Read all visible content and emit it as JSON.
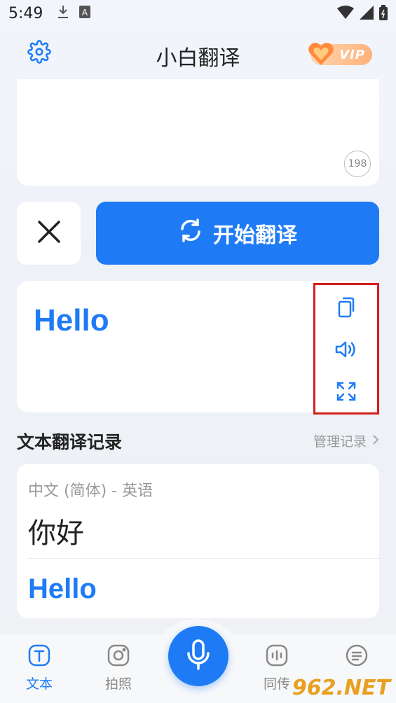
{
  "status_bar": {
    "time": "5:49",
    "icons": [
      "download-icon",
      "a-icon",
      "wifi-icon",
      "signal-icon",
      "battery-icon"
    ]
  },
  "header": {
    "title": "小白翻译",
    "vip_label": "VIP"
  },
  "input": {
    "char_count": "198"
  },
  "actions": {
    "translate_label": "开始翻译"
  },
  "result": {
    "text": "Hello",
    "action_icons": [
      "copy-icon",
      "speaker-icon",
      "fullscreen-icon"
    ]
  },
  "history": {
    "title": "文本翻译记录",
    "manage_label": "管理记录",
    "items": [
      {
        "lang": "中文 (简体) - 英语",
        "source": "你好",
        "target": "Hello"
      }
    ]
  },
  "nav": {
    "items": [
      {
        "label": "文本",
        "icon": "text-icon",
        "active": true
      },
      {
        "label": "拍照",
        "icon": "camera-icon",
        "active": false
      },
      {
        "label": "同传",
        "icon": "simultaneous-icon",
        "active": false
      },
      {
        "label": "",
        "icon": "notes-icon",
        "active": false
      }
    ]
  },
  "watermark": "962.NET",
  "colors": {
    "accent": "#1f7bf5",
    "highlight_border": "#d41e1e"
  }
}
